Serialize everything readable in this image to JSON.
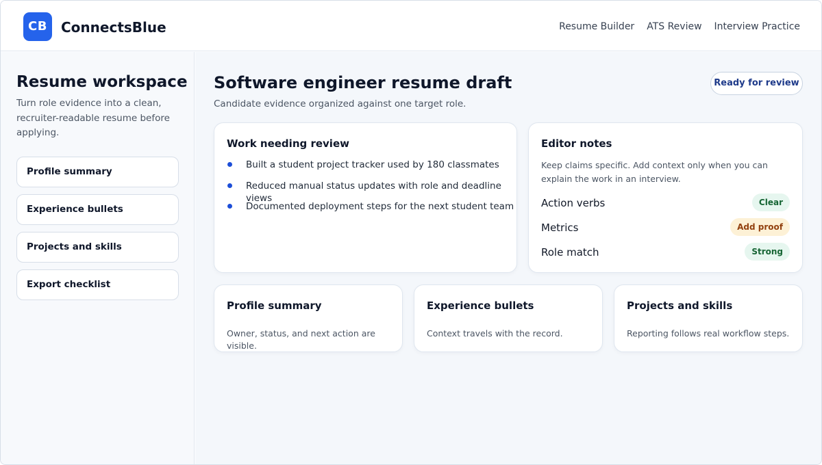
{
  "header": {
    "logo_text": "CB",
    "brand": "ConnectsBlue",
    "nav": [
      "Resume Builder",
      "ATS Review",
      "Interview Practice"
    ]
  },
  "sidebar": {
    "title": "Resume workspace",
    "description": "Turn role evidence into a clean, recruiter-readable resume before applying.",
    "items": [
      {
        "label": "Profile summary"
      },
      {
        "label": "Experience bullets"
      },
      {
        "label": "Projects and skills"
      },
      {
        "label": "Export checklist"
      }
    ]
  },
  "main": {
    "title": "Software engineer resume draft",
    "subtitle": "Candidate evidence organized against one target role.",
    "status_button": "Ready for review",
    "work_card": {
      "title": "Work needing review",
      "bullets": [
        "Built a student project tracker used by 180 classmates",
        "Reduced manual status updates with role and deadline views",
        "Documented deployment steps for the next student team"
      ]
    },
    "notes_card": {
      "title": "Editor notes",
      "description": "Keep claims specific. Add context only when you can explain the work in an interview.",
      "rows": [
        {
          "label": "Action verbs",
          "badge": "Clear"
        },
        {
          "label": "Metrics",
          "badge": "Add proof"
        },
        {
          "label": "Role match",
          "badge": "Strong"
        }
      ]
    },
    "mini_cards": [
      {
        "title": "Profile summary",
        "text": "Owner, status, and next action are visible."
      },
      {
        "title": "Experience bullets",
        "text": "Context travels with the record."
      },
      {
        "title": "Projects and skills",
        "text": "Reporting follows real workflow steps."
      }
    ]
  },
  "colors": {
    "accent": "#2563eb",
    "badge_green_bg": "#e6f6ef",
    "badge_green_text": "#166534",
    "badge_amber_bg": "#fdf1d6",
    "badge_amber_text": "#92400e"
  }
}
